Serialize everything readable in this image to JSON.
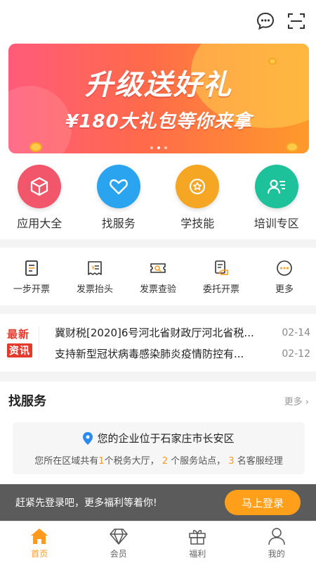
{
  "header": {
    "icons": [
      "message-icon",
      "scan-icon"
    ]
  },
  "banner": {
    "title": "升级送好礼",
    "subtitle": "¥180大礼包等你来拿",
    "dots": 3,
    "active_dot": 1
  },
  "main_categories": [
    {
      "label": "应用大全",
      "icon": "cube-icon",
      "color": "#f2566b"
    },
    {
      "label": "找服务",
      "icon": "heart-icon",
      "color": "#2aa4ee"
    },
    {
      "label": "学技能",
      "icon": "star-badge-icon",
      "color": "#f5a623"
    },
    {
      "label": "培训专区",
      "icon": "trainer-icon",
      "color": "#1ec29a"
    }
  ],
  "tools": [
    {
      "label": "一步开票",
      "icon": "invoice-icon"
    },
    {
      "label": "发票抬头",
      "icon": "receipt-header-icon"
    },
    {
      "label": "发票查验",
      "icon": "ticket-check-icon"
    },
    {
      "label": "委托开票",
      "icon": "delegate-invoice-icon"
    },
    {
      "label": "更多",
      "icon": "more-icon"
    }
  ],
  "news": {
    "badge_line1": "最新",
    "badge_line2": "资讯",
    "items": [
      {
        "title": "冀财税[2020]6号河北省财政厅河北省税...",
        "date": "02-14"
      },
      {
        "title": "支持新型冠状病毒感染肺炎疫情防控有...",
        "date": "02-12"
      }
    ]
  },
  "services": {
    "title": "找服务",
    "more": "更多",
    "location_text": "您的企业位于石家庄市长安区",
    "info": {
      "prefix": "您所在区域共有",
      "n1": "1",
      "t1": "个税务大厅，",
      "n2": "2",
      "t2": "个服务站点，",
      "n3": "3",
      "t3": "名客服经理"
    }
  },
  "login_bar": {
    "message": "赶紧先登录吧，更多福利等着你!",
    "button": "马上登录"
  },
  "tabbar": [
    {
      "label": "首页",
      "icon": "home-icon",
      "active": true
    },
    {
      "label": "会员",
      "icon": "diamond-icon",
      "active": false
    },
    {
      "label": "福利",
      "icon": "gift-icon",
      "active": false
    },
    {
      "label": "我的",
      "icon": "user-icon",
      "active": false
    }
  ],
  "colors": {
    "accent": "#ff9a1f",
    "news_red": "#e5392e"
  }
}
